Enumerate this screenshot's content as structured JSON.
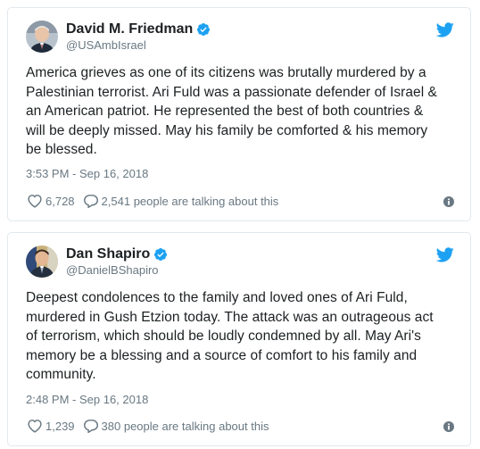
{
  "colors": {
    "border": "#e1e8ed",
    "text": "#1c2022",
    "muted": "#697882",
    "twitter_blue": "#1da1f2",
    "verified_blue": "#1da1f2"
  },
  "tweets": [
    {
      "display_name": "David M. Friedman",
      "handle": "@USAmbIsrael",
      "verified_icon": "verified-badge-icon",
      "text": "America grieves as one of its citizens was brutally murdered by a\nPalestinian terrorist. Ari Fuld was a passionate defender of Israel &\nan American patriot. He represented the best of both countries &\nwill be deeply missed. May his family be comforted & his memory\nbe blessed.",
      "timestamp": "3:53 PM - Sep 16, 2018",
      "likes": "6,728",
      "conversation": "2,541 people are talking about this"
    },
    {
      "display_name": "Dan Shapiro",
      "handle": "@DanielBShapiro",
      "verified_icon": "verified-badge-icon",
      "text": "Deepest condolences to the family and loved ones of Ari Fuld,\nmurdered in Gush Etzion today. The attack was an outrageous act\nof terrorism, which should be loudly condemned by all. May Ari's\nmemory be a blessing and a source of comfort to his family and\ncommunity.",
      "timestamp": "2:48 PM - Sep 16, 2018",
      "likes": "1,239",
      "conversation": "380 people are talking about this"
    }
  ]
}
